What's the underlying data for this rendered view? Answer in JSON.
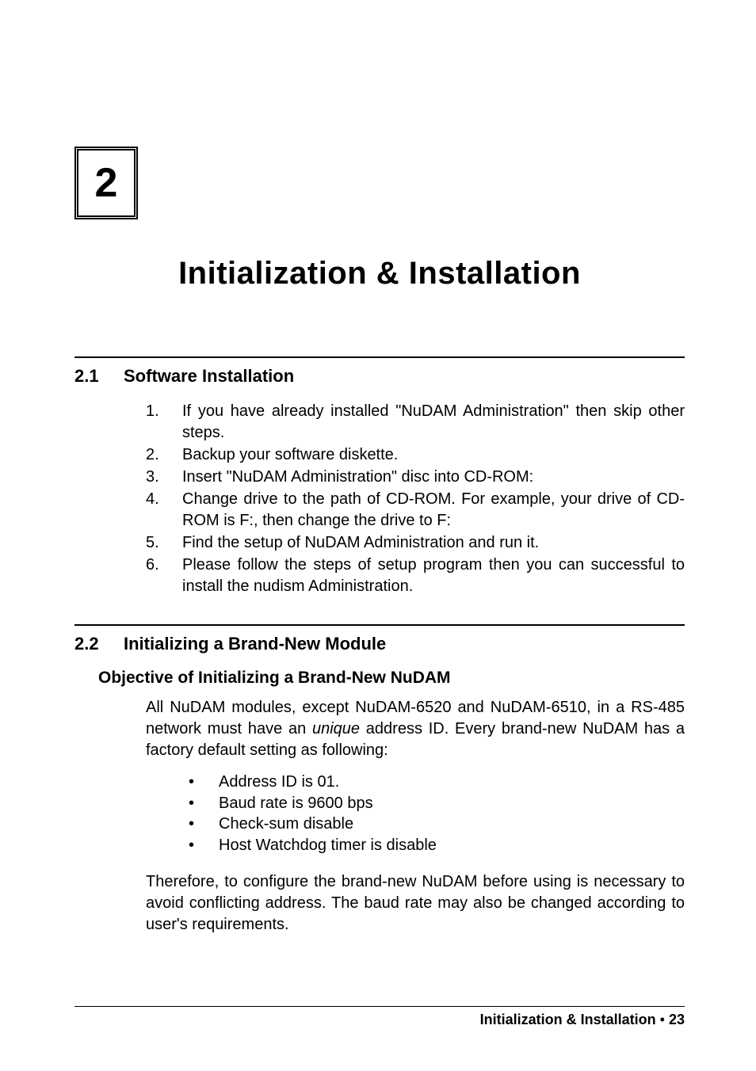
{
  "chapter": {
    "number": "2",
    "title": "Initialization & Installation"
  },
  "section1": {
    "number": "2.1",
    "title": "Software Installation",
    "steps": [
      {
        "num": "1.",
        "text": "If you have already installed \"NuDAM Administration\" then skip other steps.",
        "justify": true
      },
      {
        "num": "2.",
        "text": "Backup your software diskette.",
        "justify": false
      },
      {
        "num": "3.",
        "text": "Insert \"NuDAM Administration\" disc into CD-ROM:",
        "justify": false
      },
      {
        "num": "4.",
        "text": "Change drive to the path of CD-ROM. For example, your drive of CD-ROM is F:, then change the drive to F:",
        "justify": true
      },
      {
        "num": "5.",
        "text": "Find the setup of NuDAM Administration and run it.",
        "justify": false
      },
      {
        "num": "6.",
        "text": "Please follow the steps of setup program then you can successful to install the nudism Administration.",
        "justify": true
      }
    ]
  },
  "section2": {
    "number": "2.2",
    "title": "Initializing a Brand-New Module",
    "subsection_title": "Objective of Initializing a Brand-New NuDAM",
    "para1_pre": "All NuDAM modules, except NuDAM-6520 and NuDAM-6510, in a RS-485 network must have an ",
    "para1_italic": "unique",
    "para1_post": " address ID. Every brand-new NuDAM has a factory default setting as following:",
    "bullets": [
      "Address ID is 01.",
      "Baud rate is 9600 bps",
      "Check-sum disable",
      "Host Watchdog timer is disable"
    ],
    "para2": "Therefore, to configure the brand-new NuDAM before using is necessary to avoid conflicting address. The baud rate may also be changed according to user's requirements."
  },
  "footer": {
    "text": "Initialization & Installation",
    "separator": " • ",
    "page": "23"
  }
}
